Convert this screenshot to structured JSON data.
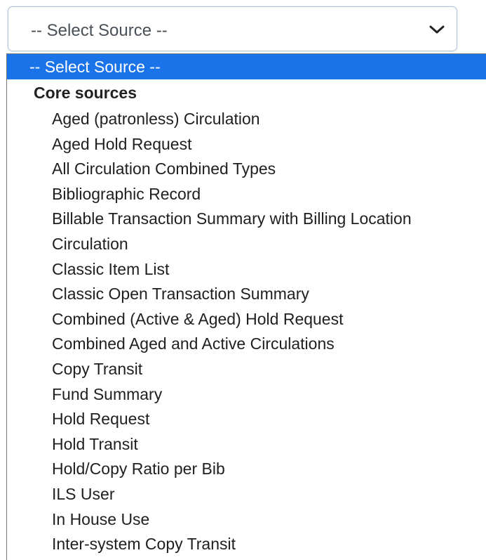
{
  "select": {
    "value": "-- Select Source --",
    "icon": "chevron-down-icon"
  },
  "dropdown": {
    "placeholder_option": "-- Select Source --",
    "group_label": "Core sources",
    "options": [
      "Aged (patronless) Circulation",
      "Aged Hold Request",
      "All Circulation Combined Types",
      "Bibliographic Record",
      "Billable Transaction Summary with Billing Location",
      "Circulation",
      "Classic Item List",
      "Classic Open Transaction Summary",
      "Combined (Active & Aged) Hold Request",
      "Combined Aged and Active Circulations",
      "Copy Transit",
      "Fund Summary",
      "Hold Request",
      "Hold Transit",
      "Hold/Copy Ratio per Bib",
      "ILS User",
      "In House Use",
      "Inter-system Copy Transit"
    ]
  },
  "colors": {
    "selected_bg": "#1a73e8",
    "selected_text": "#ffffff"
  }
}
